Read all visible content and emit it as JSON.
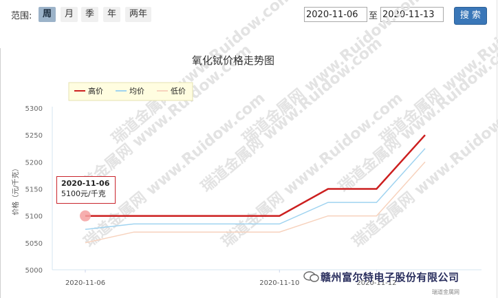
{
  "controls": {
    "range_label": "范围:",
    "periods": [
      "周",
      "月",
      "季",
      "年",
      "两年"
    ],
    "active_period": "周",
    "start_date": "2020-11-06",
    "to_label": "至",
    "end_date": "2020-11-13",
    "search_label": "搜 索"
  },
  "chart_data": {
    "type": "line",
    "title": "氧化铽价格走势图",
    "ylabel": "价格（元/千克）",
    "xlabel": "",
    "x": [
      "2020-11-06",
      "2020-11-07",
      "2020-11-08",
      "2020-11-09",
      "2020-11-10",
      "2020-11-11",
      "2020-11-12",
      "2020-11-13"
    ],
    "x_tick_labels": [
      "2020-11-06",
      "2020-11-10",
      "2020-11-12"
    ],
    "y_ticks": [
      5000,
      5050,
      5100,
      5150,
      5200,
      5250,
      5300
    ],
    "ylim": [
      5000,
      5300
    ],
    "legend_position": "top-left",
    "series": [
      {
        "name": "高价",
        "color": "#cc1f1f",
        "values": [
          5100,
          5100,
          5100,
          5100,
          5100,
          5150,
          5150,
          5250
        ]
      },
      {
        "name": "均价",
        "color": "#9fd3f0",
        "values": [
          5075,
          5085,
          5085,
          5085,
          5085,
          5125,
          5125,
          5225
        ]
      },
      {
        "name": "低价",
        "color": "#f7d2bd",
        "values": [
          5050,
          5070,
          5070,
          5070,
          5070,
          5100,
          5100,
          5200
        ]
      }
    ],
    "tooltip": {
      "date": "2020-11-06",
      "value": "5100元/千克"
    },
    "watermark": "瑞道金属网 www.Ruidow.com"
  },
  "footer": {
    "company": "赣州富尔特电子股份有限公司",
    "source": "瑞道金属网"
  },
  "colors": {
    "accent": "#3a77b8",
    "high": "#cc1f1f",
    "avg": "#9fd3f0",
    "low": "#f7d2bd"
  }
}
